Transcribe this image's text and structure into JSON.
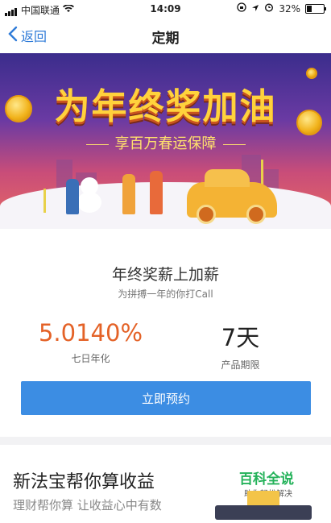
{
  "status_bar": {
    "carrier": "中国联通",
    "time": "14:09",
    "battery": "32%",
    "battery_level": 0.32
  },
  "nav": {
    "back_label": "返回",
    "title": "定期"
  },
  "banner": {
    "title": "为年终奖加油",
    "subtitle": "享百万春运保障"
  },
  "product": {
    "headline": "年终奖薪上加薪",
    "subline": "为拼搏一年的你打Call",
    "rate_value": "5.0140%",
    "rate_label": "七日年化",
    "term_value": "7天",
    "term_label": "产品期限",
    "reserve_label": "立即预约"
  },
  "promo": {
    "title": "新法宝帮你算收益",
    "subtitle": "理财帮你算 让收益心中有数",
    "brand": "百科全说",
    "tagline": "助你轻松解决"
  },
  "colors": {
    "accent_blue": "#3c8de3",
    "rate_orange": "#e46227",
    "brand_green": "#24b25a"
  }
}
